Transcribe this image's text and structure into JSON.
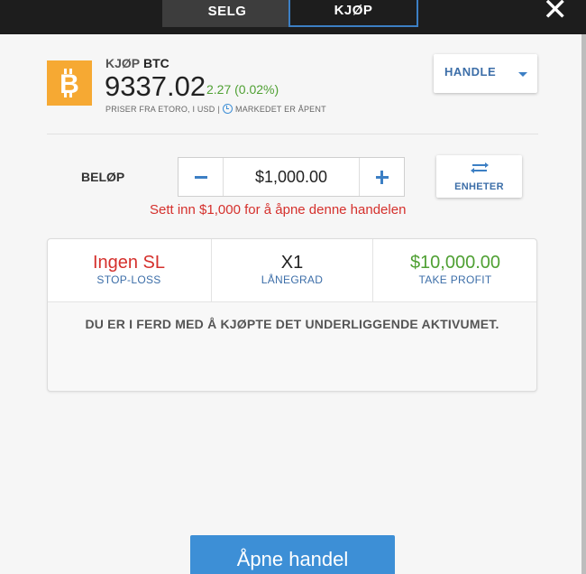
{
  "tabs": {
    "sell_label": "SELG",
    "buy_label": "KJØP"
  },
  "close_label": "✕",
  "instrument": {
    "action": "KJØP",
    "symbol": "BTC",
    "price": "9337.02",
    "change": "2.27 (0.02%)",
    "price_source": "PRISER FRA ETORO, I USD",
    "separator": "|",
    "market_status": "MARKEDET ER ÅPENT",
    "icon": "bitcoin-icon",
    "icon_color": "#f6a933"
  },
  "order_type": {
    "label": "HANDLE"
  },
  "amount": {
    "label": "BELØP",
    "value": "$1,000.00"
  },
  "units_button": {
    "label": "ENHETER"
  },
  "deposit_message": "Sett inn $1,000 for å åpne denne handelen",
  "settings": {
    "stop_loss_value": "Ingen SL",
    "stop_loss_label": "STOP-LOSS",
    "leverage_value": "X1",
    "leverage_label": "LÅNEGRAD",
    "take_profit_value": "$10,000.00",
    "take_profit_label": "TAKE PROFIT"
  },
  "info_message": "DU ER I FERD MED Å KJØPTE DET UNDERLIGGENDE AKTIVUMET.",
  "open_button_label": "Åpne handel",
  "colors": {
    "accent_blue": "#3d8fd6",
    "loss_red": "#d5302c",
    "gain_green": "#4fa033"
  }
}
